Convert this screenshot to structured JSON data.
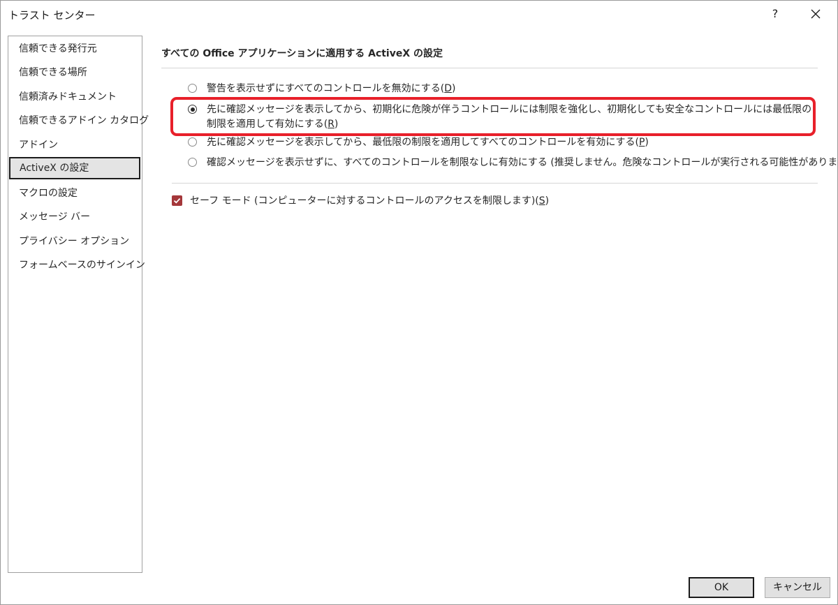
{
  "window": {
    "title": "トラスト センター",
    "help_label": "?"
  },
  "sidebar": {
    "items": [
      {
        "label": "信頼できる発行元"
      },
      {
        "label": "信頼できる場所"
      },
      {
        "label": "信頼済みドキュメント"
      },
      {
        "label": "信頼できるアドイン カタログ"
      },
      {
        "label": "アドイン"
      },
      {
        "label": "ActiveX の設定",
        "selected": true
      },
      {
        "label": "マクロの設定"
      },
      {
        "label": "メッセージ バー"
      },
      {
        "label": "プライバシー オプション"
      },
      {
        "label": "フォームベースのサインイン"
      }
    ]
  },
  "main": {
    "section_title": "すべての Office アプリケーションに適用する ActiveX の設定",
    "options": [
      {
        "label": "警告を表示せずにすべてのコントロールを無効にする(",
        "accel": "D",
        "suffix": ")",
        "checked": false
      },
      {
        "label": "先に確認メッセージを表示してから、初期化に危険が伴うコントロールには制限を強化し、初期化しても安全なコントロールには最低限の制限を適用して有効にする(",
        "accel": "R",
        "suffix": ")",
        "checked": true
      },
      {
        "label": "先に確認メッセージを表示してから、最低限の制限を適用してすべてのコントロールを有効にする(",
        "accel": "P",
        "suffix": ")",
        "checked": false
      },
      {
        "label": "確認メッセージを表示せずに、すべてのコントロールを制限なしに有効にする (推奨しません。危険なコントロールが実行される可能性があります)(",
        "accel": "E",
        "suffix": ")",
        "checked": false
      }
    ],
    "safe_mode": {
      "label": "セーフ モード (コンピューターに対するコントロールのアクセスを制限します)(",
      "accel": "S",
      "suffix": ")",
      "checked": true
    }
  },
  "buttons": {
    "ok": "OK",
    "cancel": "キャンセル"
  },
  "colors": {
    "accent_checkbox": "#a4373a",
    "highlight_annotation": "#e8202a",
    "selected_nav_bg": "#e4e4e4"
  }
}
